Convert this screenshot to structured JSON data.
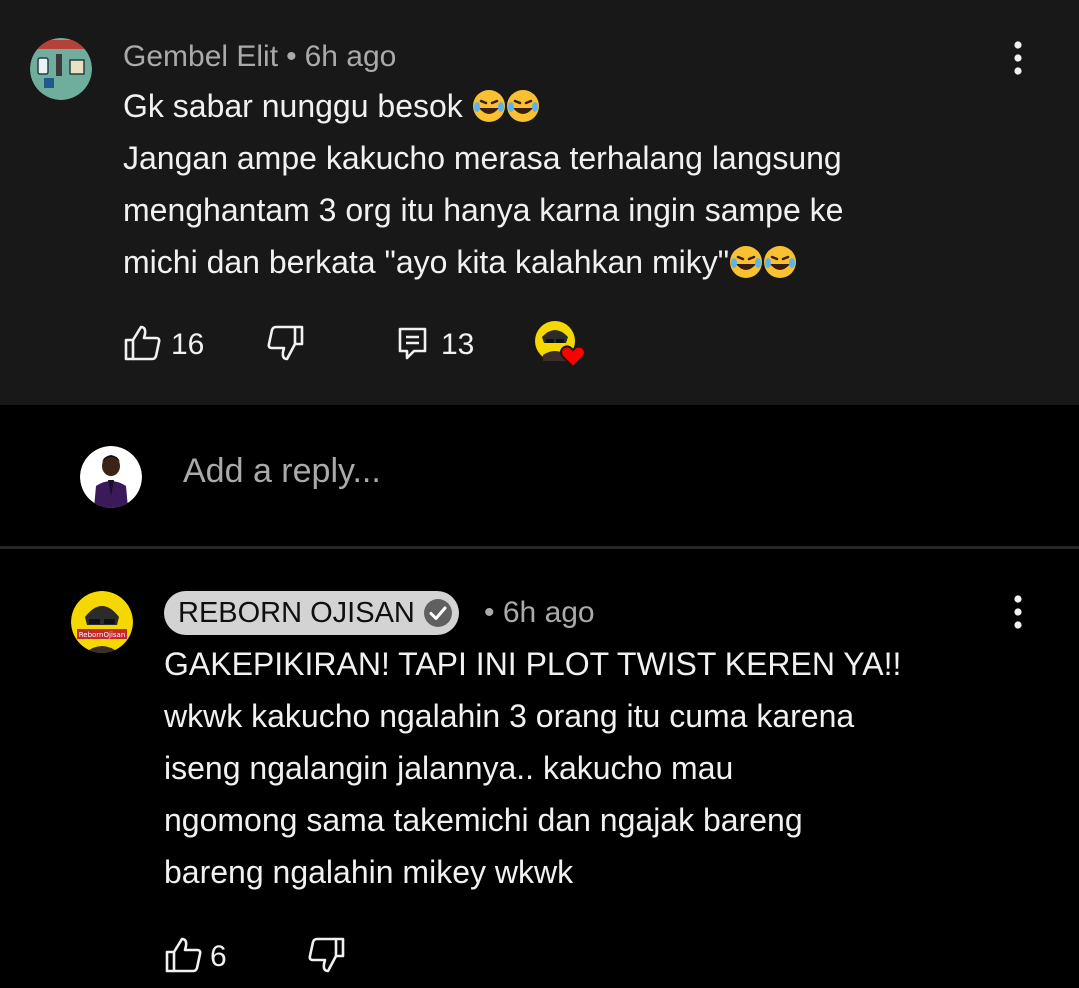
{
  "colors": {
    "top_panel_bg": "#181818",
    "page_bg": "#000000",
    "primary_text": "#f1f1f1",
    "secondary_text": "#aaaaaa",
    "chip_bg": "#d3d3d3",
    "heart": "#ff0000",
    "avatar_yellow": "#f5d800"
  },
  "main_comment": {
    "author": "Gembel Elit",
    "separator": "•",
    "time": "6h ago",
    "lines": [
      "Gk sabar nunggu besok",
      "Jangan ampe kakucho merasa terhalang langsung",
      "menghantam 3 org itu hanya karna ingin sampe ke",
      "michi dan berkata \"ayo kita kalahkan miky\""
    ],
    "line_emojis": [
      "😂😂",
      "",
      "",
      "😂😂"
    ],
    "likes": "16",
    "replies": "13",
    "icons": {
      "like": "thumbs-up-icon",
      "dislike": "thumbs-down-icon",
      "reply": "reply-comment-icon",
      "more": "more-vertical-icon",
      "creator_heart": "creator-heart-icon"
    }
  },
  "reply_box": {
    "placeholder": "Add a reply..."
  },
  "reply_comment": {
    "author": "REBORN OJISAN",
    "verified": true,
    "separator": "•",
    "time": "6h ago",
    "lines": [
      "GAKEPIKIRAN! TAPI INI PLOT TWIST KEREN YA!!",
      "wkwk kakucho ngalahin 3 orang itu cuma karena",
      "iseng ngalangin jalannya.. kakucho mau",
      "ngomong sama takemichi dan ngajak bareng",
      "bareng ngalahin mikey wkwk"
    ],
    "likes": "6",
    "avatar_label": "RebornOjisan"
  }
}
